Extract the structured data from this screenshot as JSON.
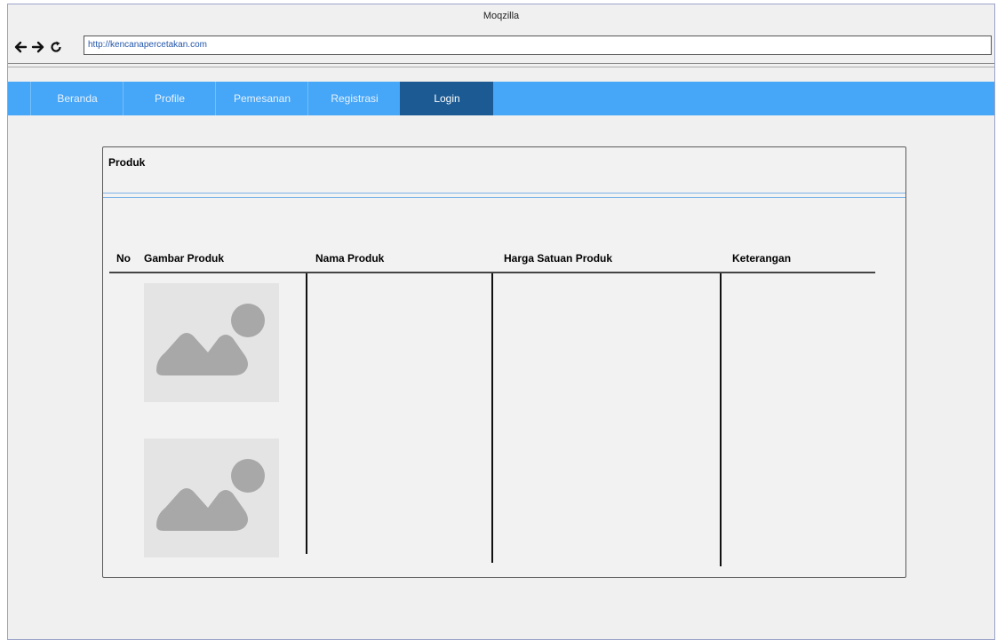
{
  "browser": {
    "title": "Moqzilla",
    "url": "http://kencanapercetakan.com",
    "icons": [
      "back-arrow-icon",
      "forward-arrow-icon",
      "reload-icon"
    ]
  },
  "menu": {
    "items": [
      {
        "label": "Beranda"
      },
      {
        "label": "Profile"
      },
      {
        "label": "Pemesanan"
      },
      {
        "label": "Registrasi"
      },
      {
        "label": "Login"
      }
    ],
    "active": "Login",
    "colors": {
      "bar": "#46a6f7",
      "active": "#1c5a93"
    }
  },
  "panel": {
    "title": "Produk",
    "table": {
      "headers": [
        "No",
        "Gambar Produk",
        "Nama Produk",
        "Harga Satuan Produk",
        "Keterangan"
      ],
      "rows": [
        {
          "no": "",
          "image": "image-placeholder-icon",
          "nama": "",
          "harga": "",
          "keterangan": ""
        },
        {
          "no": "",
          "image": "image-placeholder-icon",
          "nama": "",
          "harga": "",
          "keterangan": ""
        }
      ]
    }
  }
}
